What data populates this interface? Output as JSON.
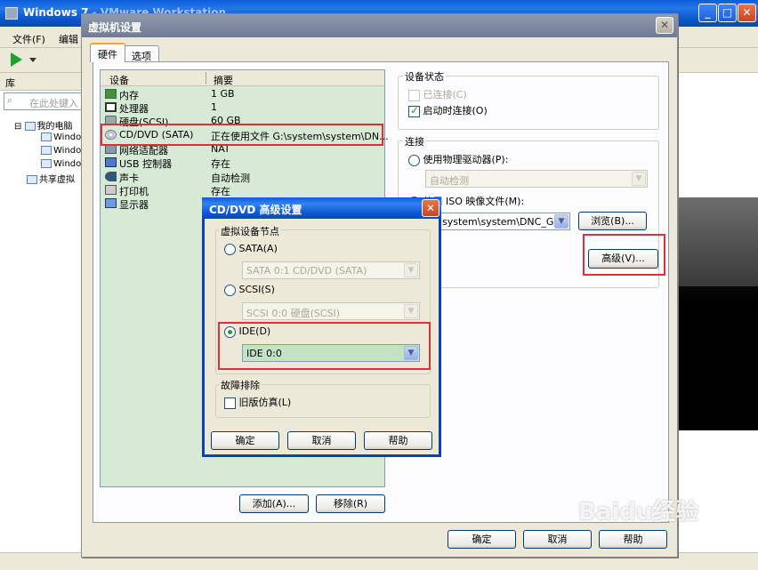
{
  "app": {
    "window_title_visible": "Windows 7",
    "window_title_faded": " - VMware Workstation",
    "menu": [
      "文件(F)",
      "编辑"
    ],
    "library_label": "库",
    "library_search_placeholder": "在此处键入",
    "tree": {
      "root": "我的电脑",
      "vms": [
        "Windo",
        "Windo",
        "Windo"
      ],
      "shared": "共享虚拟"
    }
  },
  "vm_settings": {
    "title": "虚拟机设置",
    "tabs": [
      "硬件",
      "选项"
    ],
    "columns": {
      "device": "设备",
      "summary": "摘要"
    },
    "devices": [
      {
        "name": "内存",
        "summary": "1 GB",
        "icon": "memory-icon"
      },
      {
        "name": "处理器",
        "summary": "1",
        "icon": "cpu-icon"
      },
      {
        "name": "硬盘(SCSI)",
        "summary": "60 GB",
        "icon": "harddisk-icon"
      },
      {
        "name": "CD/DVD (SATA)",
        "summary": "正在使用文件 G:\\system\\system\\DN...",
        "icon": "cdrom-icon"
      },
      {
        "name": "网络适配器",
        "summary": "NAT",
        "icon": "network-icon"
      },
      {
        "name": "USB 控制器",
        "summary": "存在",
        "icon": "usb-icon"
      },
      {
        "name": "声卡",
        "summary": "自动检测",
        "icon": "sound-icon"
      },
      {
        "name": "打印机",
        "summary": "存在",
        "icon": "printer-icon"
      },
      {
        "name": "显示器",
        "summary": "",
        "icon": "monitor-icon"
      }
    ],
    "add_button": "添加(A)...",
    "remove_button": "移除(R)",
    "device_status": {
      "label": "设备状态",
      "connected": "已连接(C)",
      "connect_at_power_on": "启动时连接(O)"
    },
    "connection": {
      "label": "连接",
      "use_physical": "使用物理驱动器(P):",
      "physical_value": "自动检测",
      "use_iso_prefix": "使用",
      "use_iso": "ISO 映像文件(M):",
      "iso_path": "system\\system\\DNC_Gho",
      "browse_button": "浏览(B)...",
      "advanced_button": "高级(V)..."
    },
    "ok_button": "确定",
    "cancel_button": "取消",
    "help_button": "帮助"
  },
  "advanced_dialog": {
    "title": "CD/DVD 高级设置",
    "virtual_device_node_label": "虚拟设备节点",
    "sata_label": "SATA(A)",
    "sata_value": "SATA 0:1   CD/DVD (SATA)",
    "scsi_label": "SCSI(S)",
    "scsi_value": "SCSI 0:0   硬盘(SCSI)",
    "ide_label": "IDE(D)",
    "ide_value": "IDE 0:0",
    "troubleshoot_label": "故障排除",
    "legacy_emulation": "旧版仿真(L)",
    "ok_button": "确定",
    "cancel_button": "取消",
    "help_button": "帮助"
  },
  "watermark": "Baidu经验",
  "colors": {
    "highlight": "#d9323a",
    "xp_blue": "#0a5fd8"
  }
}
